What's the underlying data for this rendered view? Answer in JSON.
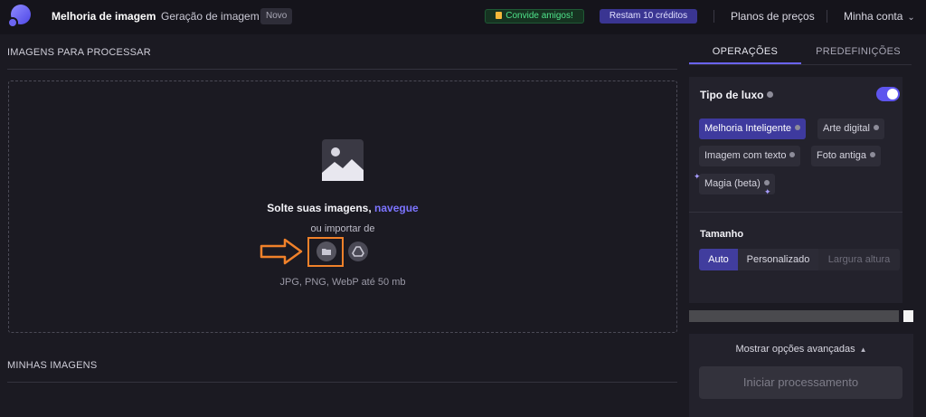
{
  "header": {
    "nav_active": "Melhoria de imagem",
    "nav_other": "Geração de imagem",
    "new_badge": "Novo",
    "invite": "Convide amigos!",
    "credits": "Restam 10 créditos",
    "plans": "Planos de preços",
    "account": "Minha conta"
  },
  "left": {
    "images_title": "IMAGENS PARA PROCESSAR",
    "drop_text": "Solte suas imagens,",
    "drop_link": "navegue",
    "import_text": "ou importar de",
    "formats": "JPG, PNG, WebP até 50 mb",
    "my_images_title": "MINHAS IMAGENS"
  },
  "right": {
    "tabs": [
      "OPERAÇÕES",
      "PREDEFINIÇÕES"
    ],
    "active_tab": "OPERAÇÕES",
    "type_title": "Tipo de luxo",
    "type_toggle_on": true,
    "chips": [
      "Melhoria Inteligente",
      "Arte digital",
      "Imagem com texto",
      "Foto antiga",
      "Magia (beta)"
    ],
    "active_chip": "Melhoria Inteligente",
    "size_title": "Tamanho",
    "size_options": [
      "Auto",
      "Personalizado",
      "Largura altura"
    ],
    "active_size": "Auto",
    "advanced": "Mostrar opções avançadas",
    "start": "Iniciar processamento"
  },
  "icons": [
    "logo",
    "gift-icon",
    "chevron-down-icon",
    "image-placeholder-icon",
    "arrow-right-icon",
    "folder-icon",
    "google-drive-icon",
    "info-dot-icon",
    "sparkle-icon",
    "chevron-up-icon"
  ],
  "colors": {
    "accent": "#6a63f2",
    "highlight": "#f0812a",
    "invite_green": "#4fe38a",
    "background": "#1b1a22"
  }
}
